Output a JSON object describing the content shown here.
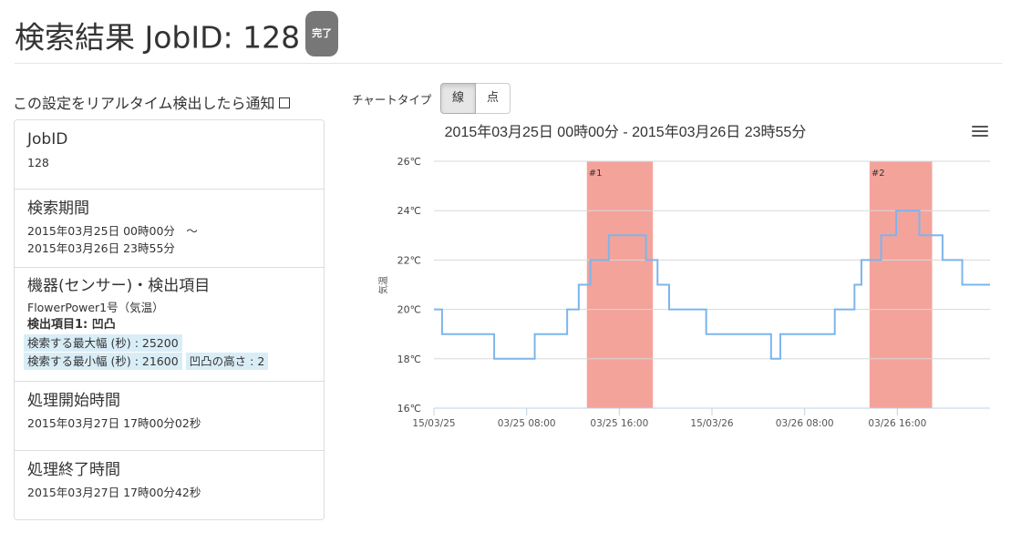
{
  "header": {
    "title": "検索結果 JobID: 128",
    "status_badge": "完了"
  },
  "notify": {
    "label": "この設定をリアルタイム検出したら通知"
  },
  "info": {
    "jobid": {
      "label": "JobID",
      "value": "128"
    },
    "period": {
      "label": "検索期間",
      "start": "2015年03月25日 00時00分　～",
      "end": "2015年03月26日 23時55分"
    },
    "device": {
      "label": "機器(センサー)・検出項目",
      "sensor": "FlowerPower1号（気温）",
      "detect_item": "検出項目1: 凹凸",
      "max_width": "検索する最大幅 (秒) : 25200",
      "min_width": "検索する最小幅 (秒) : 21600",
      "height": "凹凸の高さ : 2"
    },
    "start_time": {
      "label": "処理開始時間",
      "value": "2015年03月27日 17時00分02秒"
    },
    "end_time": {
      "label": "処理終了時間",
      "value": "2015年03月27日 17時00分42秒"
    }
  },
  "chart_controls": {
    "type_label": "チャートタイプ",
    "line_label": "線",
    "point_label": "点",
    "selected": "線"
  },
  "chart_data": {
    "type": "line",
    "title": "2015年03月25日 00時00分 - 2015年03月26日 23時55分",
    "ylabel": "気温",
    "xlabel": "",
    "ylim": [
      16,
      26
    ],
    "xlim_hours": [
      0,
      48
    ],
    "y_ticks": [
      "16℃",
      "18℃",
      "20℃",
      "22℃",
      "24℃",
      "26℃"
    ],
    "x_ticks": [
      {
        "hour": 0,
        "label": "15/03/25"
      },
      {
        "hour": 8,
        "label": "03/25 08:00"
      },
      {
        "hour": 16,
        "label": "03/25 16:00"
      },
      {
        "hour": 24,
        "label": "15/03/26"
      },
      {
        "hour": 32,
        "label": "03/26 08:00"
      },
      {
        "hour": 40,
        "label": "03/26 16:00"
      }
    ],
    "grid": true,
    "step_points": [
      [
        0,
        20
      ],
      [
        0.7,
        19
      ],
      [
        5.2,
        18
      ],
      [
        8.7,
        19
      ],
      [
        11.5,
        20
      ],
      [
        12.5,
        21
      ],
      [
        13.5,
        22
      ],
      [
        15.1,
        23
      ],
      [
        18.3,
        22
      ],
      [
        19.3,
        21
      ],
      [
        20.3,
        20
      ],
      [
        23.5,
        19
      ],
      [
        29.1,
        18
      ],
      [
        29.9,
        19
      ],
      [
        34.6,
        20
      ],
      [
        36.3,
        21
      ],
      [
        36.9,
        22
      ],
      [
        38.6,
        23
      ],
      [
        39.9,
        24
      ],
      [
        41.9,
        23
      ],
      [
        43.9,
        22
      ],
      [
        45.6,
        21
      ],
      [
        48,
        21
      ]
    ],
    "bands": [
      {
        "label": "#1",
        "from": 13.2,
        "to": 18.9
      },
      {
        "label": "#2",
        "from": 37.6,
        "to": 43.0
      }
    ],
    "colors": {
      "line": "#7cb5ec",
      "band": "#f4a39b",
      "grid": "#d8d8d8"
    }
  }
}
